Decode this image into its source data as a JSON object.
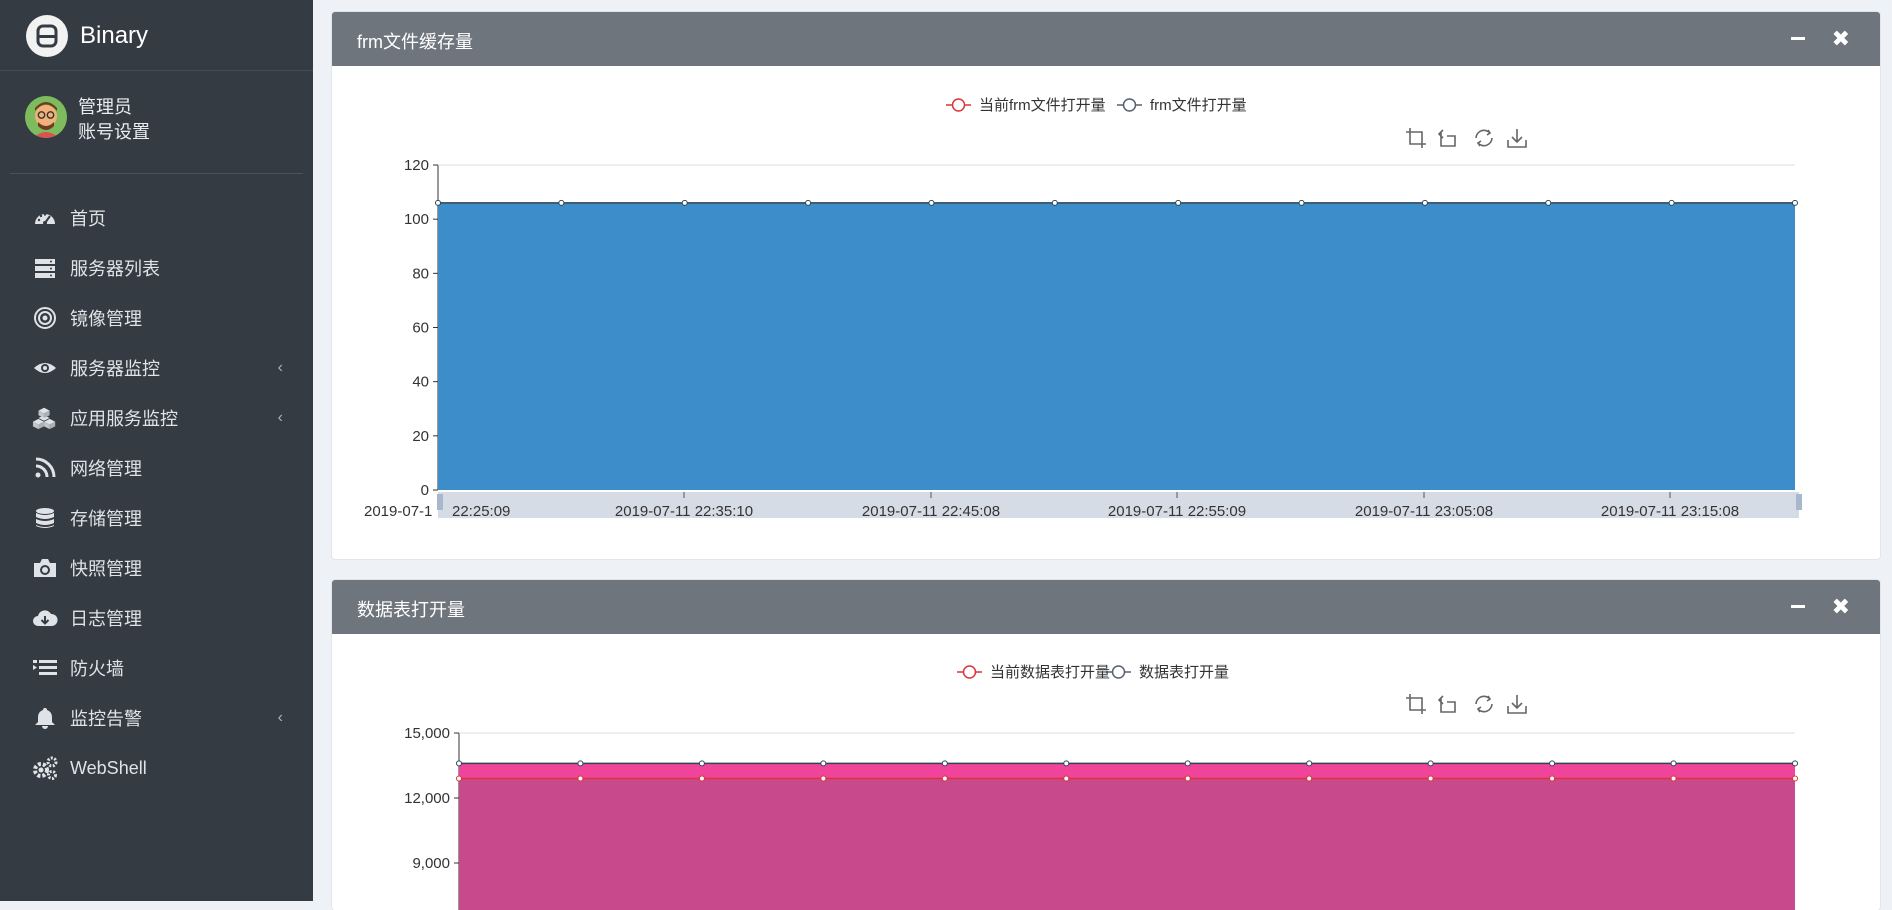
{
  "brand": {
    "name": "Binary"
  },
  "user": {
    "name": "管理员",
    "settings": "账号设置"
  },
  "menu": [
    {
      "label": "首页",
      "icon": "dashboard-icon",
      "arrow": false
    },
    {
      "label": "服务器列表",
      "icon": "server-list-icon",
      "arrow": false
    },
    {
      "label": "镜像管理",
      "icon": "target-icon",
      "arrow": false
    },
    {
      "label": "服务器监控",
      "icon": "eye-icon",
      "arrow": true
    },
    {
      "label": "应用服务监控",
      "icon": "cubes-icon",
      "arrow": true
    },
    {
      "label": "网络管理",
      "icon": "rss-icon",
      "arrow": false
    },
    {
      "label": "存储管理",
      "icon": "database-icon",
      "arrow": false
    },
    {
      "label": "快照管理",
      "icon": "camera-icon",
      "arrow": false
    },
    {
      "label": "日志管理",
      "icon": "cloud-download-icon",
      "arrow": false
    },
    {
      "label": "防火墙",
      "icon": "firewall-icon",
      "arrow": false
    },
    {
      "label": "监控告警",
      "icon": "bell-icon",
      "arrow": true
    },
    {
      "label": "WebShell",
      "icon": "gears-icon",
      "arrow": false
    }
  ],
  "menu_arrow_glyph": "‹",
  "panels": [
    {
      "title": "frm文件缓存量",
      "minimize_icon": "minus-icon",
      "close_icon": "close-icon",
      "close_glyph": "✖"
    },
    {
      "title": "数据表打开量",
      "minimize_icon": "minus-icon",
      "close_icon": "close-icon",
      "close_glyph": "✖"
    }
  ],
  "toolbox": [
    "zoom-icon",
    "zoom-reset-icon",
    "refresh-icon",
    "download-icon"
  ],
  "chart_data": [
    {
      "type": "area",
      "title": "",
      "legend": [
        "当前frm文件打开量",
        "frm文件打开量"
      ],
      "legend_position": "top-center",
      "x_tick_labels": [
        "2019-07-1",
        "22:25:09",
        "2019-07-11 22:35:10",
        "2019-07-11 22:45:08",
        "2019-07-11 22:55:09",
        "2019-07-11 23:05:08",
        "2019-07-11 23:15:08"
      ],
      "y_ticks": [
        "0",
        "20",
        "40",
        "60",
        "80",
        "100",
        "120"
      ],
      "ylim": [
        0,
        120
      ],
      "point_count": 12,
      "series": [
        {
          "name": "当前frm文件打开量",
          "values": [
            106,
            106,
            106,
            106,
            106,
            106,
            106,
            106,
            106,
            106,
            106,
            106
          ],
          "color": "#d9343a"
        },
        {
          "name": "frm文件打开量",
          "values": [
            106,
            106,
            106,
            106,
            106,
            106,
            106,
            106,
            106,
            106,
            106,
            106
          ],
          "color": "#3c8dca"
        }
      ],
      "grid": false
    },
    {
      "type": "area",
      "title": "",
      "legend": [
        "当前数据表打开量",
        "数据表打开量"
      ],
      "legend_position": "top-center",
      "y_ticks": [
        "9,000",
        "12,000",
        "15,000"
      ],
      "ylim": [
        6000,
        15000
      ],
      "point_count": 12,
      "series": [
        {
          "name": "当前数据表打开量",
          "values": [
            12900,
            12900,
            12900,
            12900,
            12900,
            12900,
            12900,
            12900,
            12900,
            12900,
            12900,
            12900
          ],
          "color": "#d9343a"
        },
        {
          "name": "数据表打开量",
          "values": [
            13600,
            13600,
            13600,
            13600,
            13600,
            13600,
            13600,
            13600,
            13600,
            13600,
            13600,
            13600
          ],
          "color": "#f0449a"
        }
      ],
      "grid": false
    }
  ]
}
